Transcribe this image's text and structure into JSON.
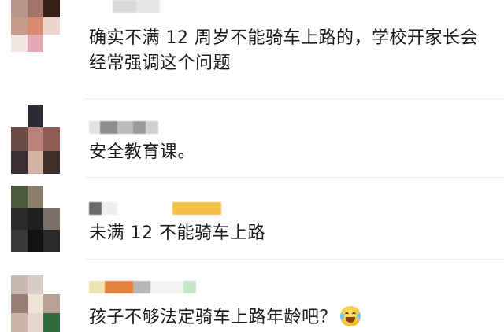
{
  "comments": [
    {
      "text_lines": [
        "确实不满 12 周岁不能骑车上路的，学校开家长会",
        "经常强调这个问题"
      ],
      "avatar_colors": [
        "#b8968a",
        "#a2766a",
        "#3a1f18",
        "#c79a8a",
        "#d98a6f",
        "#e9d6cf",
        "#f2e6e2",
        "#e2a8b6",
        "#ffffff"
      ],
      "name_colors": [
        "#ffffff",
        "#d9d9d9",
        "#e7e7e7"
      ]
    },
    {
      "text_lines": [
        "安全教育课。"
      ],
      "avatar_colors": [
        "#ffffff",
        "#2c2a33",
        "#ffffff",
        "#6b4a48",
        "#b9827a",
        "#8e5c52",
        "#3b2f33",
        "#d3b3a2",
        "#3d2e2b"
      ],
      "name_colors": [
        "#e3e3e3",
        "#8f8f8f",
        "#bdbdbd",
        "#9a9a9a",
        "#cfcfcf"
      ]
    },
    {
      "text_lines": [
        "未满 12 不能骑车上路"
      ],
      "avatar_colors": [
        "#4a5a3a",
        "#8a7e6a",
        "#ffffff",
        "#2b2b2b",
        "#1f1f1f",
        "#7a7068",
        "#3a3a3a",
        "#111111",
        "#2a2a2a"
      ],
      "name_colors": [
        "#6a6a6a",
        "#efefef",
        "#ffffff",
        "#f4c142"
      ]
    },
    {
      "text_lines": [
        "孩子不够法定骑车上路年龄吧？"
      ],
      "avatar_colors": [
        "#c8b8b0",
        "#d7cbc6",
        "#ffffff",
        "#9a7f76",
        "#efe3da",
        "#b8a394",
        "#cdb4a8",
        "#e3d7cd",
        "#2f6b3e"
      ],
      "name_colors": [
        "#f0e3b2",
        "#e3823a",
        "#b7b7b7",
        "#f3f3f3",
        "#c4e6c7"
      ],
      "emoji": "crying-laughing-emoji"
    }
  ]
}
